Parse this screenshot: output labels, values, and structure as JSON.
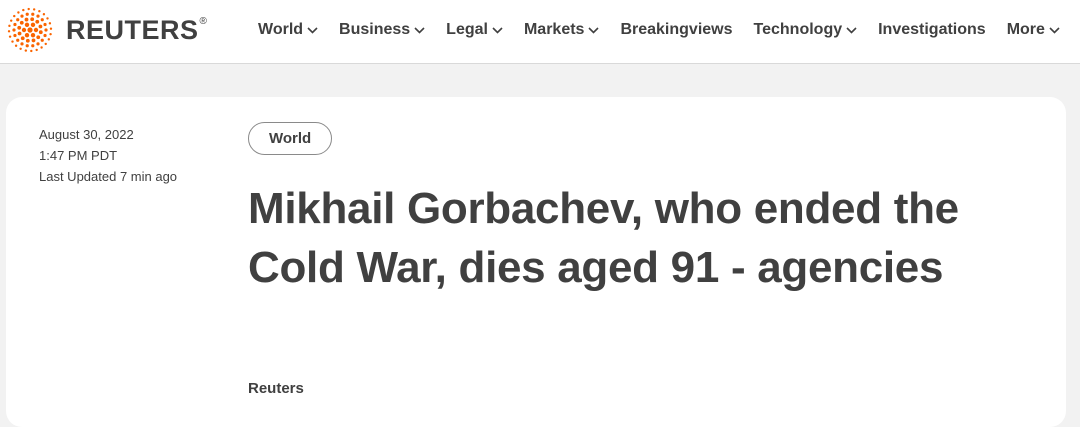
{
  "header": {
    "logo": {
      "wordmark": "REUTERS",
      "registered": "®",
      "icon": "reuters-dot-logo-icon",
      "accent_color": "#fa6400"
    },
    "nav": [
      {
        "label": "World",
        "has_dropdown": true
      },
      {
        "label": "Business",
        "has_dropdown": true
      },
      {
        "label": "Legal",
        "has_dropdown": true
      },
      {
        "label": "Markets",
        "has_dropdown": true
      },
      {
        "label": "Breakingviews",
        "has_dropdown": false
      },
      {
        "label": "Technology",
        "has_dropdown": true
      },
      {
        "label": "Investigations",
        "has_dropdown": false
      },
      {
        "label": "More",
        "has_dropdown": true
      }
    ]
  },
  "article": {
    "date": "August 30, 2022",
    "time": "1:47 PM PDT",
    "updated": "Last Updated 7 min ago",
    "section_tag": "World",
    "headline": "Mikhail Gorbachev, who ended the Cold War, dies aged 91 - agencies",
    "byline": "Reuters"
  }
}
